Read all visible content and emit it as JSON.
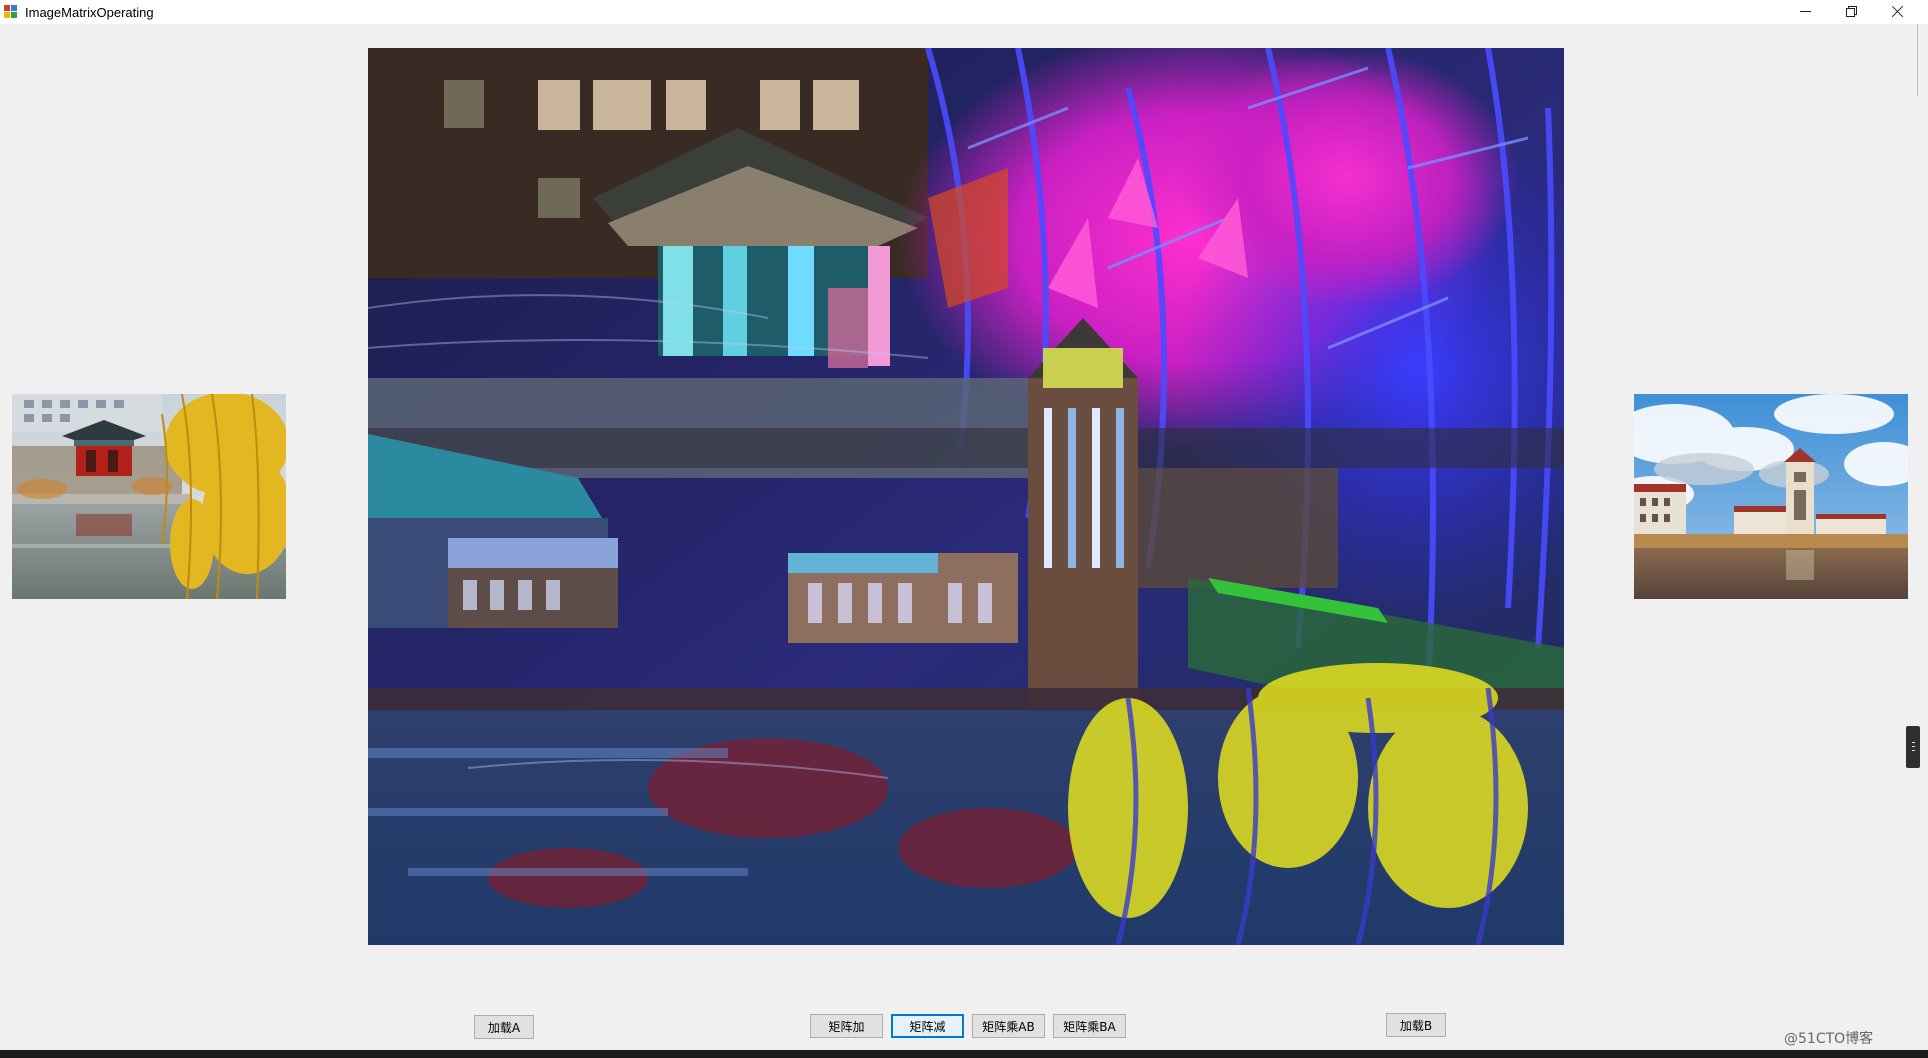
{
  "window": {
    "title": "ImageMatrixOperating",
    "icon": "app-window-icon",
    "controls": [
      "minimize-icon",
      "restore-icon",
      "close-icon"
    ]
  },
  "images": {
    "a": "image-a-pavilion-willow-photo",
    "main": "matrix-operation-result-image",
    "b": "image-b-clock-tower-photo"
  },
  "buttons": {
    "load_a": "加载A",
    "add": "矩阵加",
    "subtract": "矩阵减",
    "multiply_ab": "矩阵乘AB",
    "multiply_ba": "矩阵乘BA",
    "load_b": "加载B"
  },
  "watermark": "@51CTO博客",
  "colors": {
    "focus_border": "#0078d7",
    "button_face": "#e1e1e1",
    "form_background": "#f0f0f0"
  }
}
